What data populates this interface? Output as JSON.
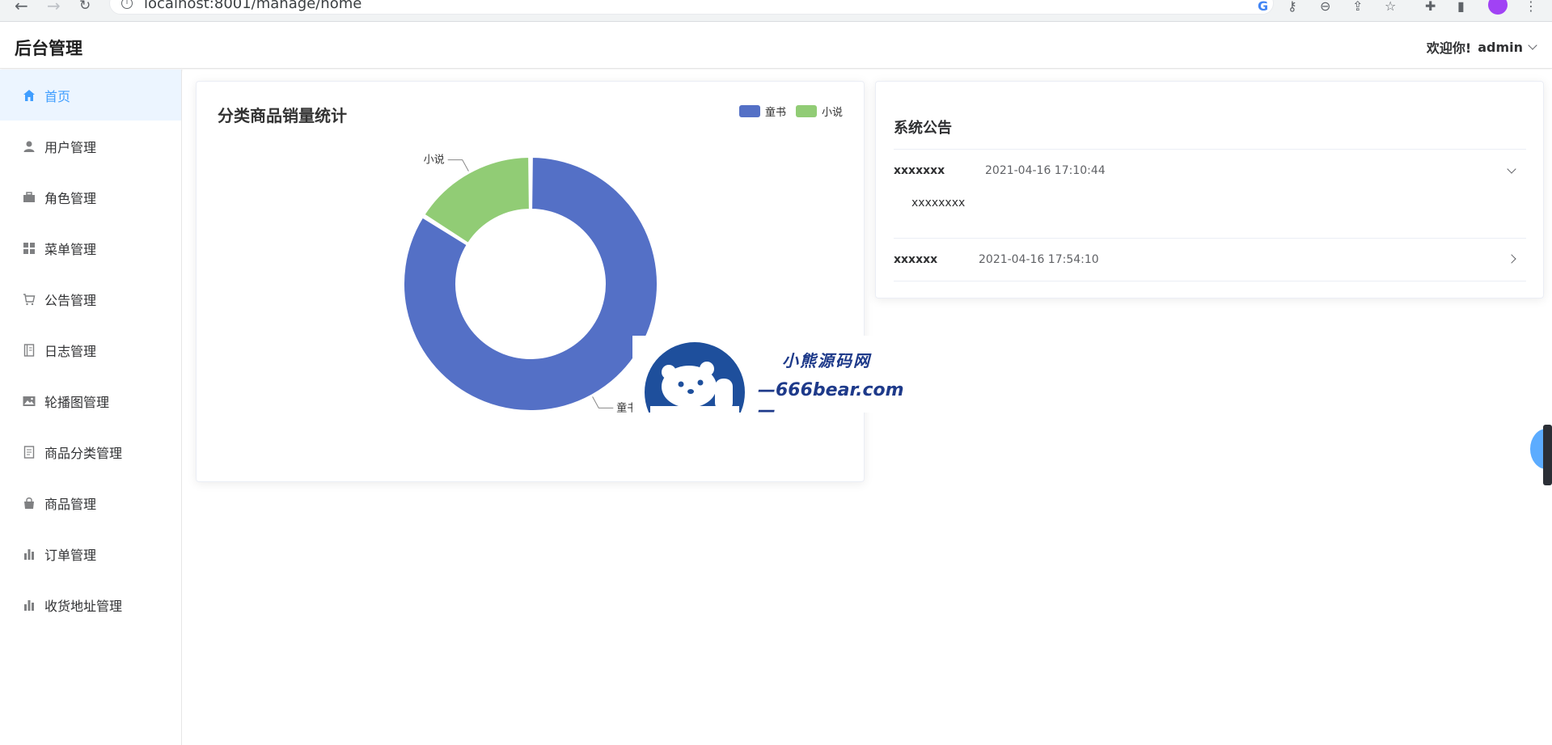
{
  "browser": {
    "url": "localhost:8001/manage/home"
  },
  "header": {
    "title": "后台管理",
    "welcome": "欢迎你!",
    "username": "admin"
  },
  "sidebar": {
    "items": [
      {
        "label": "首页",
        "icon": "home-icon",
        "active": true
      },
      {
        "label": "用户管理",
        "icon": "user-icon"
      },
      {
        "label": "角色管理",
        "icon": "briefcase-icon"
      },
      {
        "label": "菜单管理",
        "icon": "grid-icon"
      },
      {
        "label": "公告管理",
        "icon": "cart-icon"
      },
      {
        "label": "日志管理",
        "icon": "notebook-icon"
      },
      {
        "label": "轮播图管理",
        "icon": "picture-icon"
      },
      {
        "label": "商品分类管理",
        "icon": "document-icon"
      },
      {
        "label": "商品管理",
        "icon": "shopping-bag-icon"
      },
      {
        "label": "订单管理",
        "icon": "bar-chart-icon"
      },
      {
        "label": "收货地址管理",
        "icon": "bar-chart-icon"
      }
    ],
    "active_color": "#409eff"
  },
  "chart_data": {
    "type": "pie",
    "title": "分类商品销量统计",
    "donut": true,
    "legend_position": "top-right",
    "slices": [
      {
        "name": "童书",
        "value": 84,
        "color": "#5470c6"
      },
      {
        "name": "小说",
        "value": 16,
        "color": "#91cc75"
      }
    ]
  },
  "notice": {
    "title": "系统公告",
    "items": [
      {
        "name": "xxxxxxx",
        "time": "2021-04-16 17:10:44",
        "expanded": true,
        "body": "xxxxxxxx"
      },
      {
        "name": "xxxxxx",
        "time": "2021-04-16 17:54:10",
        "expanded": false
      }
    ]
  },
  "watermark": {
    "line1": "小熊源码网",
    "line2": "—666bear.com—"
  }
}
